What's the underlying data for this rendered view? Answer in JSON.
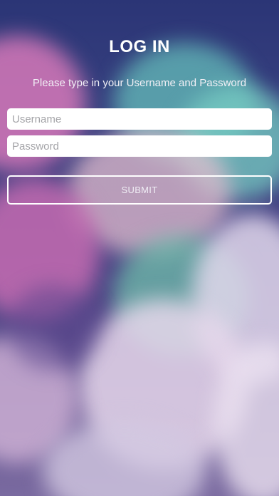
{
  "login": {
    "title": "LOG IN",
    "subtitle": "Please type in your Username and Password",
    "username": {
      "placeholder": "Username",
      "value": ""
    },
    "password": {
      "placeholder": "Password",
      "value": ""
    },
    "submit_label": "SUBMIT"
  },
  "colors": {
    "background_top": "#2b3576",
    "background_bottom": "#7a6aa0",
    "bokeh_pink": "#d678b9",
    "bokeh_teal": "#64beb9",
    "bokeh_light": "#e6d7eb",
    "field_background": "#ffffff",
    "submit_border": "#ffffff"
  }
}
